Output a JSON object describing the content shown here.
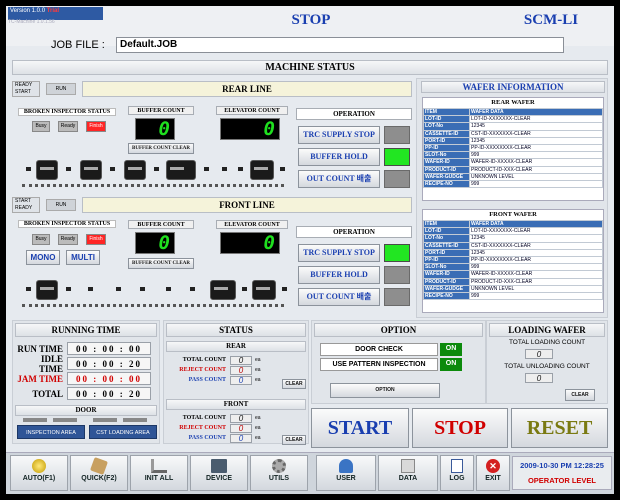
{
  "header": {
    "version": "Version 1.0.0",
    "trial": "Trial",
    "machine_sub": "TC-Machine 1.0.1.56",
    "status": "STOP",
    "model": "SCM-LI",
    "job_label": "JOB FILE :",
    "job_value": "Default.JOB",
    "machine_status": "MACHINE STATUS"
  },
  "rear_line": {
    "ready": "READY",
    "start": "START",
    "run": "RUN",
    "title": "REAR LINE",
    "bis_title": "BROKEN INSPECTOR STATUS",
    "chips": [
      "Busy",
      "Ready",
      "Finish"
    ],
    "buffer_title": "BUFFER COUNT",
    "buffer_value": "0",
    "buffer_clear": "BUFFER COUNT CLEAR",
    "elevator_title": "ELEVATOR COUNT",
    "elevator_value": "0",
    "operation_title": "OPERATION",
    "op_buttons": [
      "TRC SUPPLY STOP",
      "BUFFER HOLD",
      "OUT COUNT 배출"
    ]
  },
  "front_line": {
    "start": "START",
    "ready": "READY",
    "run": "RUN",
    "title": "FRONT LINE",
    "bis_title": "BROKEN INSPECTOR STATUS",
    "chips": [
      "Busy",
      "Ready",
      "Finish"
    ],
    "mono": "MONO",
    "multi": "MULTI",
    "buffer_title": "BUFFER COUNT",
    "buffer_value": "0",
    "buffer_clear": "BUFFER COUNT CLEAR",
    "elevator_title": "ELEVATOR COUNT",
    "elevator_value": "0",
    "operation_title": "OPERATION",
    "op_buttons": [
      "TRC SUPPLY STOP",
      "BUFFER HOLD",
      "OUT COUNT 배출"
    ]
  },
  "wafer_info": {
    "title": "WAFER INFORMATION",
    "rear_title": "REAR WAFER",
    "front_title": "FRONT WAFER",
    "head": [
      "ITEM",
      "WAFER DATA"
    ],
    "rear_rows": [
      [
        "LOT-ID",
        "LOT-ID-XXXXXXX-CLEAR"
      ],
      [
        "LOT-No",
        "12345"
      ],
      [
        "CASSETTE-ID",
        "CST-ID-XXXXXXX-CLEAR"
      ],
      [
        "PORT-ID",
        "12345"
      ],
      [
        "PP-ID",
        "PP-ID-XXXXXXXX-CLEAR"
      ],
      [
        "SLOT-No",
        "999"
      ],
      [
        "WAFER-ID",
        "WAFER-ID-XXXXX-CLEAR"
      ],
      [
        "PRODUCT-ID",
        "PRODUCT-ID-XXX-CLEAR"
      ],
      [
        "WAFER-GUDGE",
        "UNKNOWN LEVEL"
      ],
      [
        "RECIPE-NO",
        "999"
      ]
    ],
    "front_rows": [
      [
        "LOT-ID",
        "LOT-ID-XXXXXXX-CLEAR"
      ],
      [
        "LOT-No",
        "12345"
      ],
      [
        "CASSETTE-ID",
        "CST-ID-XXXXXXX-CLEAR"
      ],
      [
        "PORT-ID",
        "12345"
      ],
      [
        "PP-ID",
        "PP-ID-XXXXXXXX-CLEAR"
      ],
      [
        "SLOT-No",
        "999"
      ],
      [
        "WAFER-ID",
        "WAFER-ID-XXXXX-CLEAR"
      ],
      [
        "PRODUCT-ID",
        "PRODUCT-ID-XXX-CLEAR"
      ],
      [
        "WAFER-GUDGE",
        "UNKNOWN LEVEL"
      ],
      [
        "RECIPE-NO",
        "999"
      ]
    ]
  },
  "running_time": {
    "title": "RUNNING TIME",
    "rows": [
      {
        "label": "RUN TIME",
        "value": "00 : 00 : 00"
      },
      {
        "label": "IDLE TIME",
        "value": "00 : 00 : 20"
      },
      {
        "label": "JAM TIME",
        "value": "00 : 00 : 00"
      },
      {
        "label": "TOTAL",
        "value": "00 : 00 : 20"
      }
    ]
  },
  "door": {
    "title": "DOOR",
    "inspection_area": "INSPECTION AREA",
    "cst_loading_area": "CST LOADING AREA"
  },
  "status": {
    "title": "STATUS",
    "rear_title": "REAR",
    "front_title": "FRONT",
    "total_label": "TOTAL COUNT",
    "reject_label": "REJECT COUNT",
    "pass_label": "PASS COUNT",
    "unit": "ea",
    "clear": "CLEAR",
    "rear_values": [
      "0",
      "0",
      "0"
    ],
    "front_values": [
      "0",
      "0",
      "0"
    ]
  },
  "option": {
    "title": "OPTION",
    "door_check": "DOOR CHECK",
    "door_check_state": "ON",
    "use_pattern": "USE PATTERN INSPECTION",
    "use_pattern_state": "ON",
    "option_btn": "OPTION"
  },
  "loading_wafer": {
    "title": "LOADING WAFER",
    "total_loading_label": "TOTAL LOADING COUNT",
    "total_loading_value": "0",
    "total_unloading_label": "TOTAL UNLOADING COUNT",
    "total_unloading_value": "0",
    "clear": "CLEAR"
  },
  "controls": {
    "start": "START",
    "stop": "STOP",
    "reset": "RESET"
  },
  "toolbar": {
    "items": [
      {
        "label": "AUTO(F1)",
        "icon": "auto-icon"
      },
      {
        "label": "QUICK(F2)",
        "icon": "quick-icon"
      },
      {
        "label": "INIT ALL",
        "icon": "init-icon"
      },
      {
        "label": "DEVICE",
        "icon": "device-icon"
      },
      {
        "label": "UTILS",
        "icon": "gear-icon"
      },
      {
        "label": "USER",
        "icon": "user-icon"
      },
      {
        "label": "DATA",
        "icon": "data-icon"
      },
      {
        "label": "LOG",
        "icon": "log-icon"
      },
      {
        "label": "EXIT",
        "icon": "exit-icon"
      }
    ],
    "datetime": "2009-10-30 PM 12:28:25",
    "operator": "OPERATOR LEVEL"
  },
  "colors": {
    "accent": "#1a3fb0",
    "stop": "#d00000",
    "green_lamp": "#22e622",
    "table_head": "#3a6db5"
  }
}
